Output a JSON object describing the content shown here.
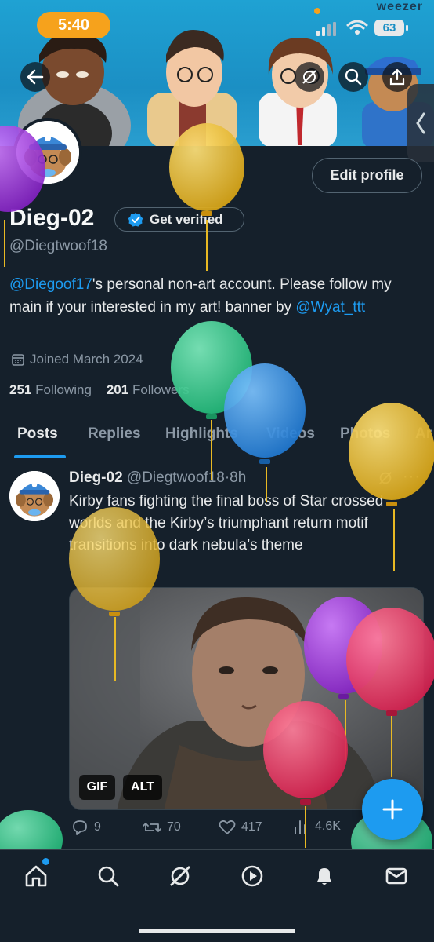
{
  "status_bar": {
    "time": "5:40",
    "now_playing": "weezer",
    "battery": "63"
  },
  "profile": {
    "display_name": "Dieg-02",
    "verify_label": "Get verified",
    "handle": "@Diegtwoof18",
    "edit_label": "Edit profile",
    "bio": {
      "mention1": "@Diegoof17",
      "text1": "'s personal non-art account. Please follow my main if your interested in my art! banner by ",
      "mention2": "@Wyat_ttt"
    },
    "joined": "Joined March 2024",
    "following_count": "251",
    "following_label": "Following",
    "followers_count": "201",
    "followers_label": "Followers"
  },
  "tabs": [
    {
      "label": "Posts"
    },
    {
      "label": "Replies"
    },
    {
      "label": "Highlights"
    },
    {
      "label": "Videos"
    },
    {
      "label": "Photos"
    },
    {
      "label": "Ar"
    }
  ],
  "tweet": {
    "name": "Dieg-02",
    "handle": "@Diegtwoof18",
    "sep": "·",
    "age": "8h",
    "more": "···",
    "text": "Kirby fans fighting the final boss of Star crossed worlds and the Kirby’s triumphant return motif transitions into dark nebula’s theme",
    "badge_gif": "GIF",
    "badge_alt": "ALT",
    "replies": "9",
    "reposts": "70",
    "likes": "417",
    "views": "4.6K"
  },
  "colors": {
    "background": "#15202b",
    "accent": "#1d9bf0",
    "secondary_text": "#8b98a5",
    "balloon_yellow": "#e8b923",
    "balloon_green": "#2ecf8b",
    "balloon_blue": "#2e8fe0",
    "balloon_purple": "#9b32d6",
    "balloon_red": "#e6365f"
  },
  "icons": [
    "back-arrow-icon",
    "grok-icon",
    "search-icon",
    "share-icon",
    "side-panel-chevron-icon",
    "verified-badge-icon",
    "calendar-icon",
    "reply-icon",
    "repost-icon",
    "like-icon",
    "views-icon",
    "compose-plus-icon",
    "home-icon",
    "explore-icon",
    "grok-nav-icon",
    "spaces-icon",
    "notifications-icon",
    "messages-icon"
  ]
}
